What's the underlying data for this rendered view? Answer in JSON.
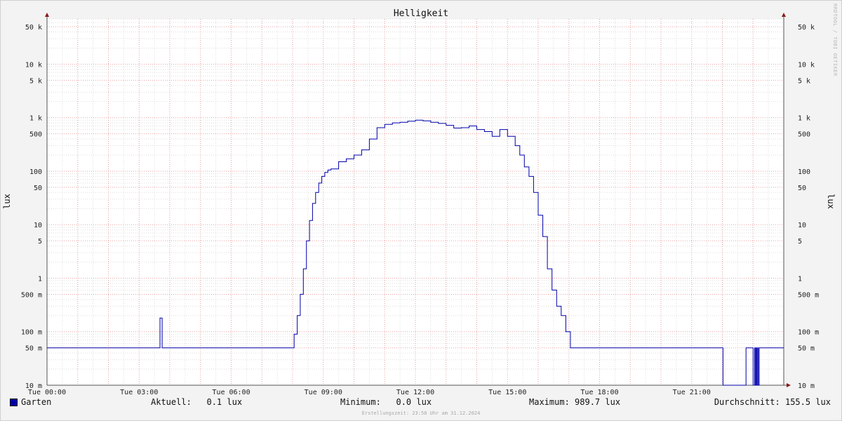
{
  "chart_data": {
    "type": "line",
    "title": "Helligkeit",
    "ylabel": "lux",
    "yscale": "log",
    "ylim": [
      0.01,
      70000
    ],
    "grid": true,
    "xlim_hours": [
      0,
      24
    ],
    "x_ticks": [
      {
        "h": 0,
        "label": "Tue 00:00"
      },
      {
        "h": 3,
        "label": "Tue 03:00"
      },
      {
        "h": 6,
        "label": "Tue 06:00"
      },
      {
        "h": 9,
        "label": "Tue 09:00"
      },
      {
        "h": 12,
        "label": "Tue 12:00"
      },
      {
        "h": 15,
        "label": "Tue 15:00"
      },
      {
        "h": 18,
        "label": "Tue 18:00"
      },
      {
        "h": 21,
        "label": "Tue 21:00"
      }
    ],
    "y_ticks": [
      {
        "v": 0.01,
        "label": "10 m"
      },
      {
        "v": 0.05,
        "label": "50 m"
      },
      {
        "v": 0.1,
        "label": "100 m"
      },
      {
        "v": 0.5,
        "label": "500 m"
      },
      {
        "v": 1,
        "label": "1"
      },
      {
        "v": 5,
        "label": "5"
      },
      {
        "v": 10,
        "label": "10"
      },
      {
        "v": 50,
        "label": "50"
      },
      {
        "v": 100,
        "label": "100"
      },
      {
        "v": 500,
        "label": "500"
      },
      {
        "v": 1000,
        "label": "1 k"
      },
      {
        "v": 5000,
        "label": "5 k"
      },
      {
        "v": 10000,
        "label": "10 k"
      },
      {
        "v": 50000,
        "label": "50 k"
      }
    ],
    "series": [
      {
        "name": "Garten",
        "color": "#0000aa",
        "x_hours": [
          0,
          3.65,
          3.68,
          3.72,
          3.75,
          8.0,
          8.05,
          8.15,
          8.25,
          8.35,
          8.45,
          8.55,
          8.65,
          8.75,
          8.85,
          8.95,
          9.05,
          9.15,
          9.25,
          9.5,
          9.75,
          10.0,
          10.25,
          10.5,
          10.75,
          11.0,
          11.25,
          11.5,
          11.75,
          12.0,
          12.25,
          12.5,
          12.75,
          13.0,
          13.25,
          13.5,
          13.75,
          14.0,
          14.25,
          14.5,
          14.75,
          15.0,
          15.25,
          15.4,
          15.55,
          15.7,
          15.85,
          16.0,
          16.15,
          16.3,
          16.45,
          16.6,
          16.75,
          16.9,
          17.05,
          17.15,
          17.25,
          17.35,
          17.45,
          17.55,
          17.6,
          22.0,
          22.02,
          22.75,
          22.77,
          22.98,
          23.0,
          23.05,
          23.07,
          23.1,
          23.12,
          23.15,
          23.17,
          23.2,
          23.22,
          24.0
        ],
        "y_lux": [
          0.05,
          0.05,
          0.18,
          0.18,
          0.05,
          0.05,
          0.09,
          0.2,
          0.5,
          1.5,
          5,
          12,
          25,
          40,
          60,
          80,
          95,
          105,
          110,
          150,
          170,
          200,
          250,
          400,
          650,
          750,
          800,
          820,
          860,
          900,
          870,
          820,
          780,
          720,
          640,
          650,
          700,
          600,
          550,
          450,
          600,
          450,
          300,
          200,
          120,
          80,
          40,
          15,
          6,
          1.5,
          0.6,
          0.3,
          0.2,
          0.1,
          0.05,
          0.05,
          0.05,
          0.05,
          0.05,
          0.05,
          0.05,
          0.05,
          0.01,
          0.01,
          0.05,
          0.05,
          0.01,
          0.05,
          0.01,
          0.05,
          0.01,
          0.05,
          0.01,
          0.05,
          0.05,
          0.05
        ]
      }
    ]
  },
  "legend": {
    "series_name": "Garten",
    "current": "Aktuell:   0.1 lux",
    "minimum": "Minimum:   0.0 lux",
    "maximum": "Maximum: 989.7 lux",
    "average": "Durchschnitt: 155.5 lux"
  },
  "footer": "Erstellungszeit: 23:58 Uhr am 31.12.2024",
  "watermark": "RRDTOOL / TOBI OETIKER"
}
